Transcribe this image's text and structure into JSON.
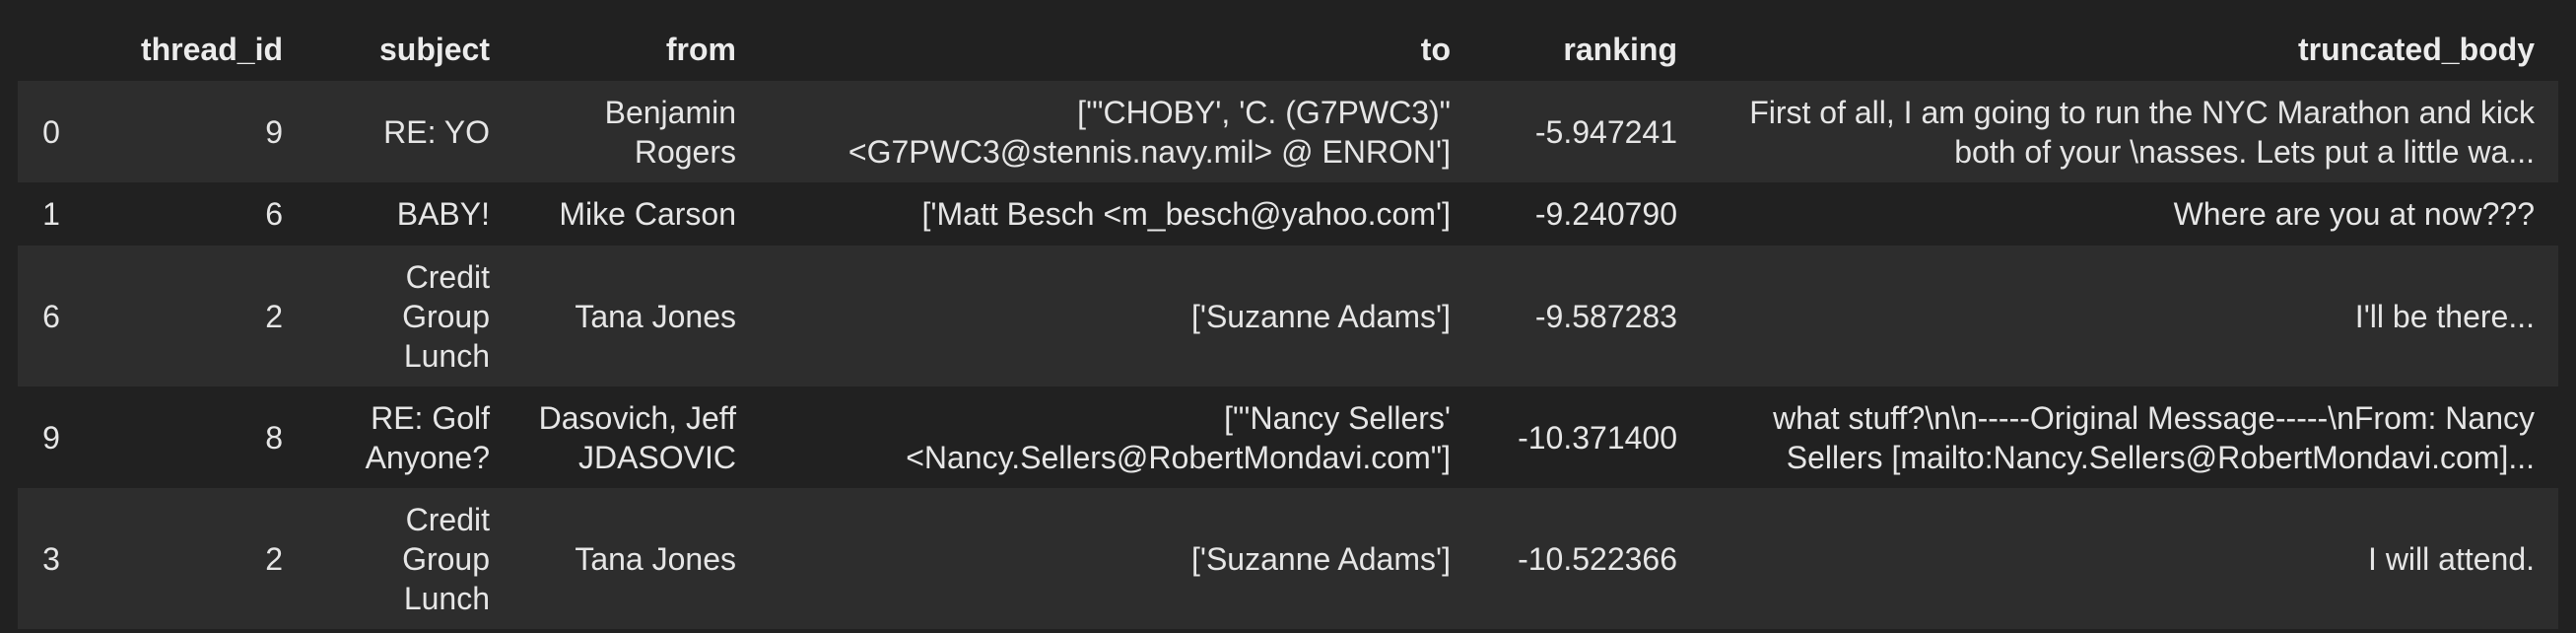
{
  "table": {
    "columns": [
      "",
      "thread_id",
      "subject",
      "from",
      "to",
      "ranking",
      "truncated_body"
    ],
    "rows": [
      {
        "index": "0",
        "thread_id": "9",
        "subject": "RE: YO",
        "from": "Benjamin Rogers",
        "to": "['\"CHOBY', 'C. (G7PWC3)\" <G7PWC3@stennis.navy.mil> @ ENRON']",
        "ranking": "-5.947241",
        "truncated_body": "First of all, I am going to run the NYC Marathon and kick both of your \\nasses. Lets put a little wa..."
      },
      {
        "index": "1",
        "thread_id": "6",
        "subject": "BABY!",
        "from": "Mike Carson",
        "to": "['Matt Besch <m_besch@yahoo.com']",
        "ranking": "-9.240790",
        "truncated_body": "Where are you at now???"
      },
      {
        "index": "6",
        "thread_id": "2",
        "subject": "Credit Group Lunch",
        "from": "Tana Jones",
        "to": "['Suzanne Adams']",
        "ranking": "-9.587283",
        "truncated_body": "I'll be there..."
      },
      {
        "index": "9",
        "thread_id": "8",
        "subject": "RE: Golf Anyone?",
        "from": "Dasovich, Jeff JDASOVIC",
        "to": "[\"'Nancy Sellers' <Nancy.Sellers@RobertMondavi.com\"]",
        "ranking": "-10.371400",
        "truncated_body": "what stuff?\\n\\n-----Original Message-----\\nFrom: Nancy Sellers [mailto:Nancy.Sellers@RobertMondavi.com]..."
      },
      {
        "index": "3",
        "thread_id": "2",
        "subject": "Credit Group Lunch",
        "from": "Tana Jones",
        "to": "['Suzanne Adams']",
        "ranking": "-10.522366",
        "truncated_body": "I will attend."
      }
    ]
  }
}
